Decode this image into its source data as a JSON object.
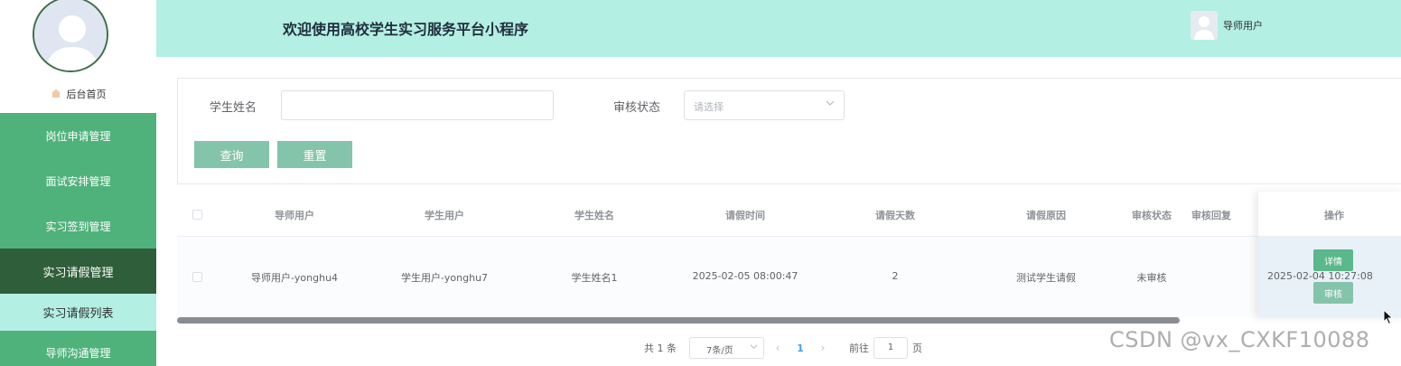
{
  "app": {
    "title": "欢迎使用高校学生实习服务平台小程序",
    "user_name": "导师用户"
  },
  "sidebar": {
    "home_label": "后台首页",
    "items": [
      {
        "label": "岗位申请管理"
      },
      {
        "label": "面试安排管理"
      },
      {
        "label": "实习签到管理"
      },
      {
        "label": "实习请假管理"
      },
      {
        "label": "实习请假列表"
      },
      {
        "label": "导师沟通管理"
      }
    ]
  },
  "search": {
    "student_name_label": "学生姓名",
    "student_name_value": "",
    "status_label": "审核状态",
    "status_placeholder": "请选择",
    "query_button": "查询",
    "reset_button": "重置"
  },
  "table": {
    "columns": [
      "导师用户",
      "学生用户",
      "学生姓名",
      "请假时间",
      "请假天数",
      "请假原因",
      "审核状态",
      "审核回复",
      "操作"
    ],
    "rows": [
      {
        "mentor_user": "导师用户-yonghu4",
        "student_user": "学生用户-yonghu7",
        "student_name": "学生姓名1",
        "leave_time": "2025-02-05 08:00:47",
        "leave_days": "2",
        "leave_reason": "测试学生请假",
        "audit_status": "未审核",
        "audit_reply": "",
        "hidden_date": "2025-02-04 10:27:08",
        "detail_button": "详情",
        "audit_button": "审核"
      }
    ]
  },
  "pagination": {
    "total": "共 1 条",
    "page_size": "7条/页",
    "current_page": "1",
    "goto_label": "前往",
    "goto_value": "1",
    "page_suffix": "页"
  },
  "watermark": "CSDN @vx_CXKF10088",
  "colors": {
    "header_bg": "#b3efe2",
    "menu_bg": "#4fb27a",
    "menu_active": "#2f5f3a",
    "button_bg": "#84c4ab",
    "accent": "#409eff"
  }
}
